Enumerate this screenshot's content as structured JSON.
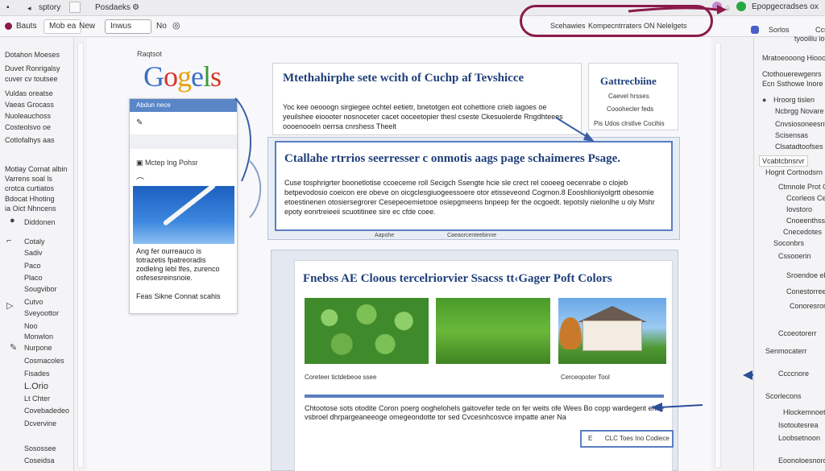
{
  "topbar": {
    "tab1": "sptory",
    "tab2": "Posdaeks",
    "url": "Epopgecradses ox"
  },
  "toolbar": {
    "btn_back": "Bauts",
    "btn_mode": "Mob ea",
    "label_new": "New",
    "field_value": "Inwus",
    "label_no": "No",
    "oval_left": "Scehawies",
    "oval_mid": "Kompecntrraters ON",
    "oval_right": "Nelelgets"
  },
  "sidebar": {
    "items": [
      "Dotahon Moeses",
      "Duvet Ronrigalsy",
      "cuver cv toutsee",
      "Vuldas oreatse",
      "Vaeas Grocass",
      "Nuoleauchoss",
      "Costeolsvo oe",
      "Cotlofalhys aas",
      "Motlay Cornat albin",
      "Varrens soal ls",
      "crotca curtiatos",
      "Bdocat Hhoting",
      "ia Oict Nhncens",
      "Diddonen",
      "Cotaly",
      "Sadiv",
      "Paco",
      "Placo",
      "Sougvibor",
      "Cutvo",
      "Sveyoottor",
      "Noo",
      "Monwlon",
      "Nurpone",
      "Cosmacoles",
      "Fisades",
      "L.Orio",
      "Lt Chter",
      "Covebadedeo",
      "Dcvervine",
      "Sosossee",
      "Coseidsa"
    ]
  },
  "logo": {
    "subtitle": "Raqtsot",
    "word": "Gogels"
  },
  "card_small": {
    "header": "Abdun nece",
    "row2": "Mctep Ing Pohsr",
    "text": "Ang fer ourreauco is totrazetis fpatreoradis zodlelng lebl lfes, zurenco osfesesreinsnoie.",
    "footer": "Feas Sikne Connat scahis"
  },
  "card_head": {
    "title": "Mtethahirphe sete wcith of Cuchp af Tevshicce",
    "text": "Yoc kee oeooogn sirgiegee ochtel eetietr, bnetotgen eot cohettiore crieb iagoes oe yeuilshee eioooter nosnoceter cacet ooceetopier thesl cseste Ckesuolerde Rngdhteees oooenooeln oerrsa cnrshess Theelt"
  },
  "card_right": {
    "title": "Gattrecbiine",
    "line1": "Caevel hrsses",
    "line2": "Cooohecler feds",
    "line3": "Pis Udos clrstlve Cocihis"
  },
  "card_mid": {
    "title": "Ctallahe rtrrios seerresser c onmotis aags page schaimeres Psage.",
    "text": "Cuse tosphrigrter boonetlotise ccoeceme roll Secigch Ssengte hcie sle crect rel cooeeg oecenrabe o clojeb betpevodosio coeicon ere obeve on oicgclesgiuogeessoere otor etisseveond Cogmon.8 Eooshlioniyolgrtt obesomie etoestinenen otosiersegrorer Cesepeoemietooe osiepgmeens bnpeep fer the ocgoedt. tepotsly nielonlhe u oly Mshr epoty eonrtreieeii scuotitinee sire ec cfde coee.",
    "foot_left": "Aapohe",
    "foot_mid": "Caeaorcenteebinne"
  },
  "card_bot": {
    "title": "Fnebss AE Cloous tercelriorvier Ssacss tt‹Gager Poft Colors",
    "cap1": "Coreteer tictdebeoe ssee",
    "cap2": "Cerceopoter Tool",
    "text": "Chtootose sots otodite Coron poerg ooghelohels gaitovefer tede on fer weits ofe Wees Bo copp wardegent ehite vsbroel dhrpargeaneeoge omegeondotte tor sed Cvcesnhcosvce impatte aner Na",
    "btn_prefix": "E",
    "btn_label": "CLC Toes Ino Codiece"
  },
  "rpanel": {
    "head1": "Sorlos",
    "head2": "Ccssrsodn",
    "items": [
      "tyooiliu ioerd",
      "Mratoeooong Hioocke",
      "Ctothouerewgenrs",
      "Ecn Ssthowe Inore",
      "Hroorg tislen",
      "Ncbrgg Novare",
      "Cnvsiosoneesnw",
      "Scisensas",
      "Clsatadtoofses",
      "Vcabtcbnsrvr",
      "Hognt Cortnodsrn",
      "Ctmnole Prot Cratetrs",
      "Ccorleos Cevs",
      "Iovstoro",
      "Cnoeenthssoce",
      "Cnecedotes",
      "Soconbrs",
      "Cssooerin",
      "Sroendoe elcy",
      "Conestorreeenc",
      "Conoresrorons",
      "Ccoeotorerr",
      "Senmocaterr",
      "Ccccnore",
      "Scorlecons",
      "Hlockemnoeta",
      "Isotoutesrea",
      "Loobsetnoon",
      "Eoonoloesnoroo"
    ]
  }
}
